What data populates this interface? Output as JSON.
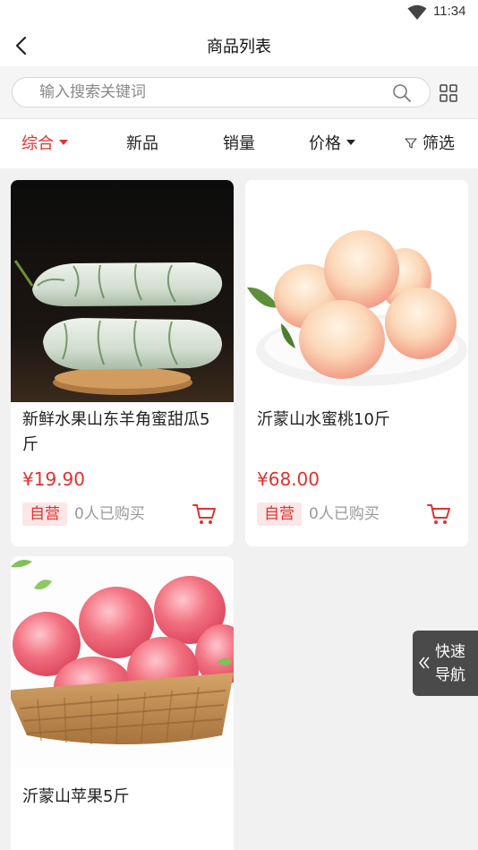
{
  "status": {
    "time": "11:34"
  },
  "header": {
    "title": "商品列表"
  },
  "search": {
    "placeholder": "输入搜索关键词"
  },
  "sort": {
    "comprehensive": "综合",
    "new": "新品",
    "sales": "销量",
    "price": "价格",
    "filter": "筛选"
  },
  "colors": {
    "accent": "#e1322d",
    "tag_bg": "#fde6e6",
    "page_bg": "#f1f1f1"
  },
  "products": [
    {
      "name": "新鲜水果山东羊角蜜甜瓜5斤",
      "price": "¥19.90",
      "tag": "自营",
      "sold": "0人已购买",
      "image": "melon-photo"
    },
    {
      "name": "沂蒙山水蜜桃10斤",
      "price": "¥68.00",
      "tag": "自营",
      "sold": "0人已购买",
      "image": "peach-photo"
    },
    {
      "name": "沂蒙山苹果5斤",
      "image": "apple-photo"
    }
  ],
  "quick_nav": {
    "line1": "快速",
    "line2": "导航"
  }
}
